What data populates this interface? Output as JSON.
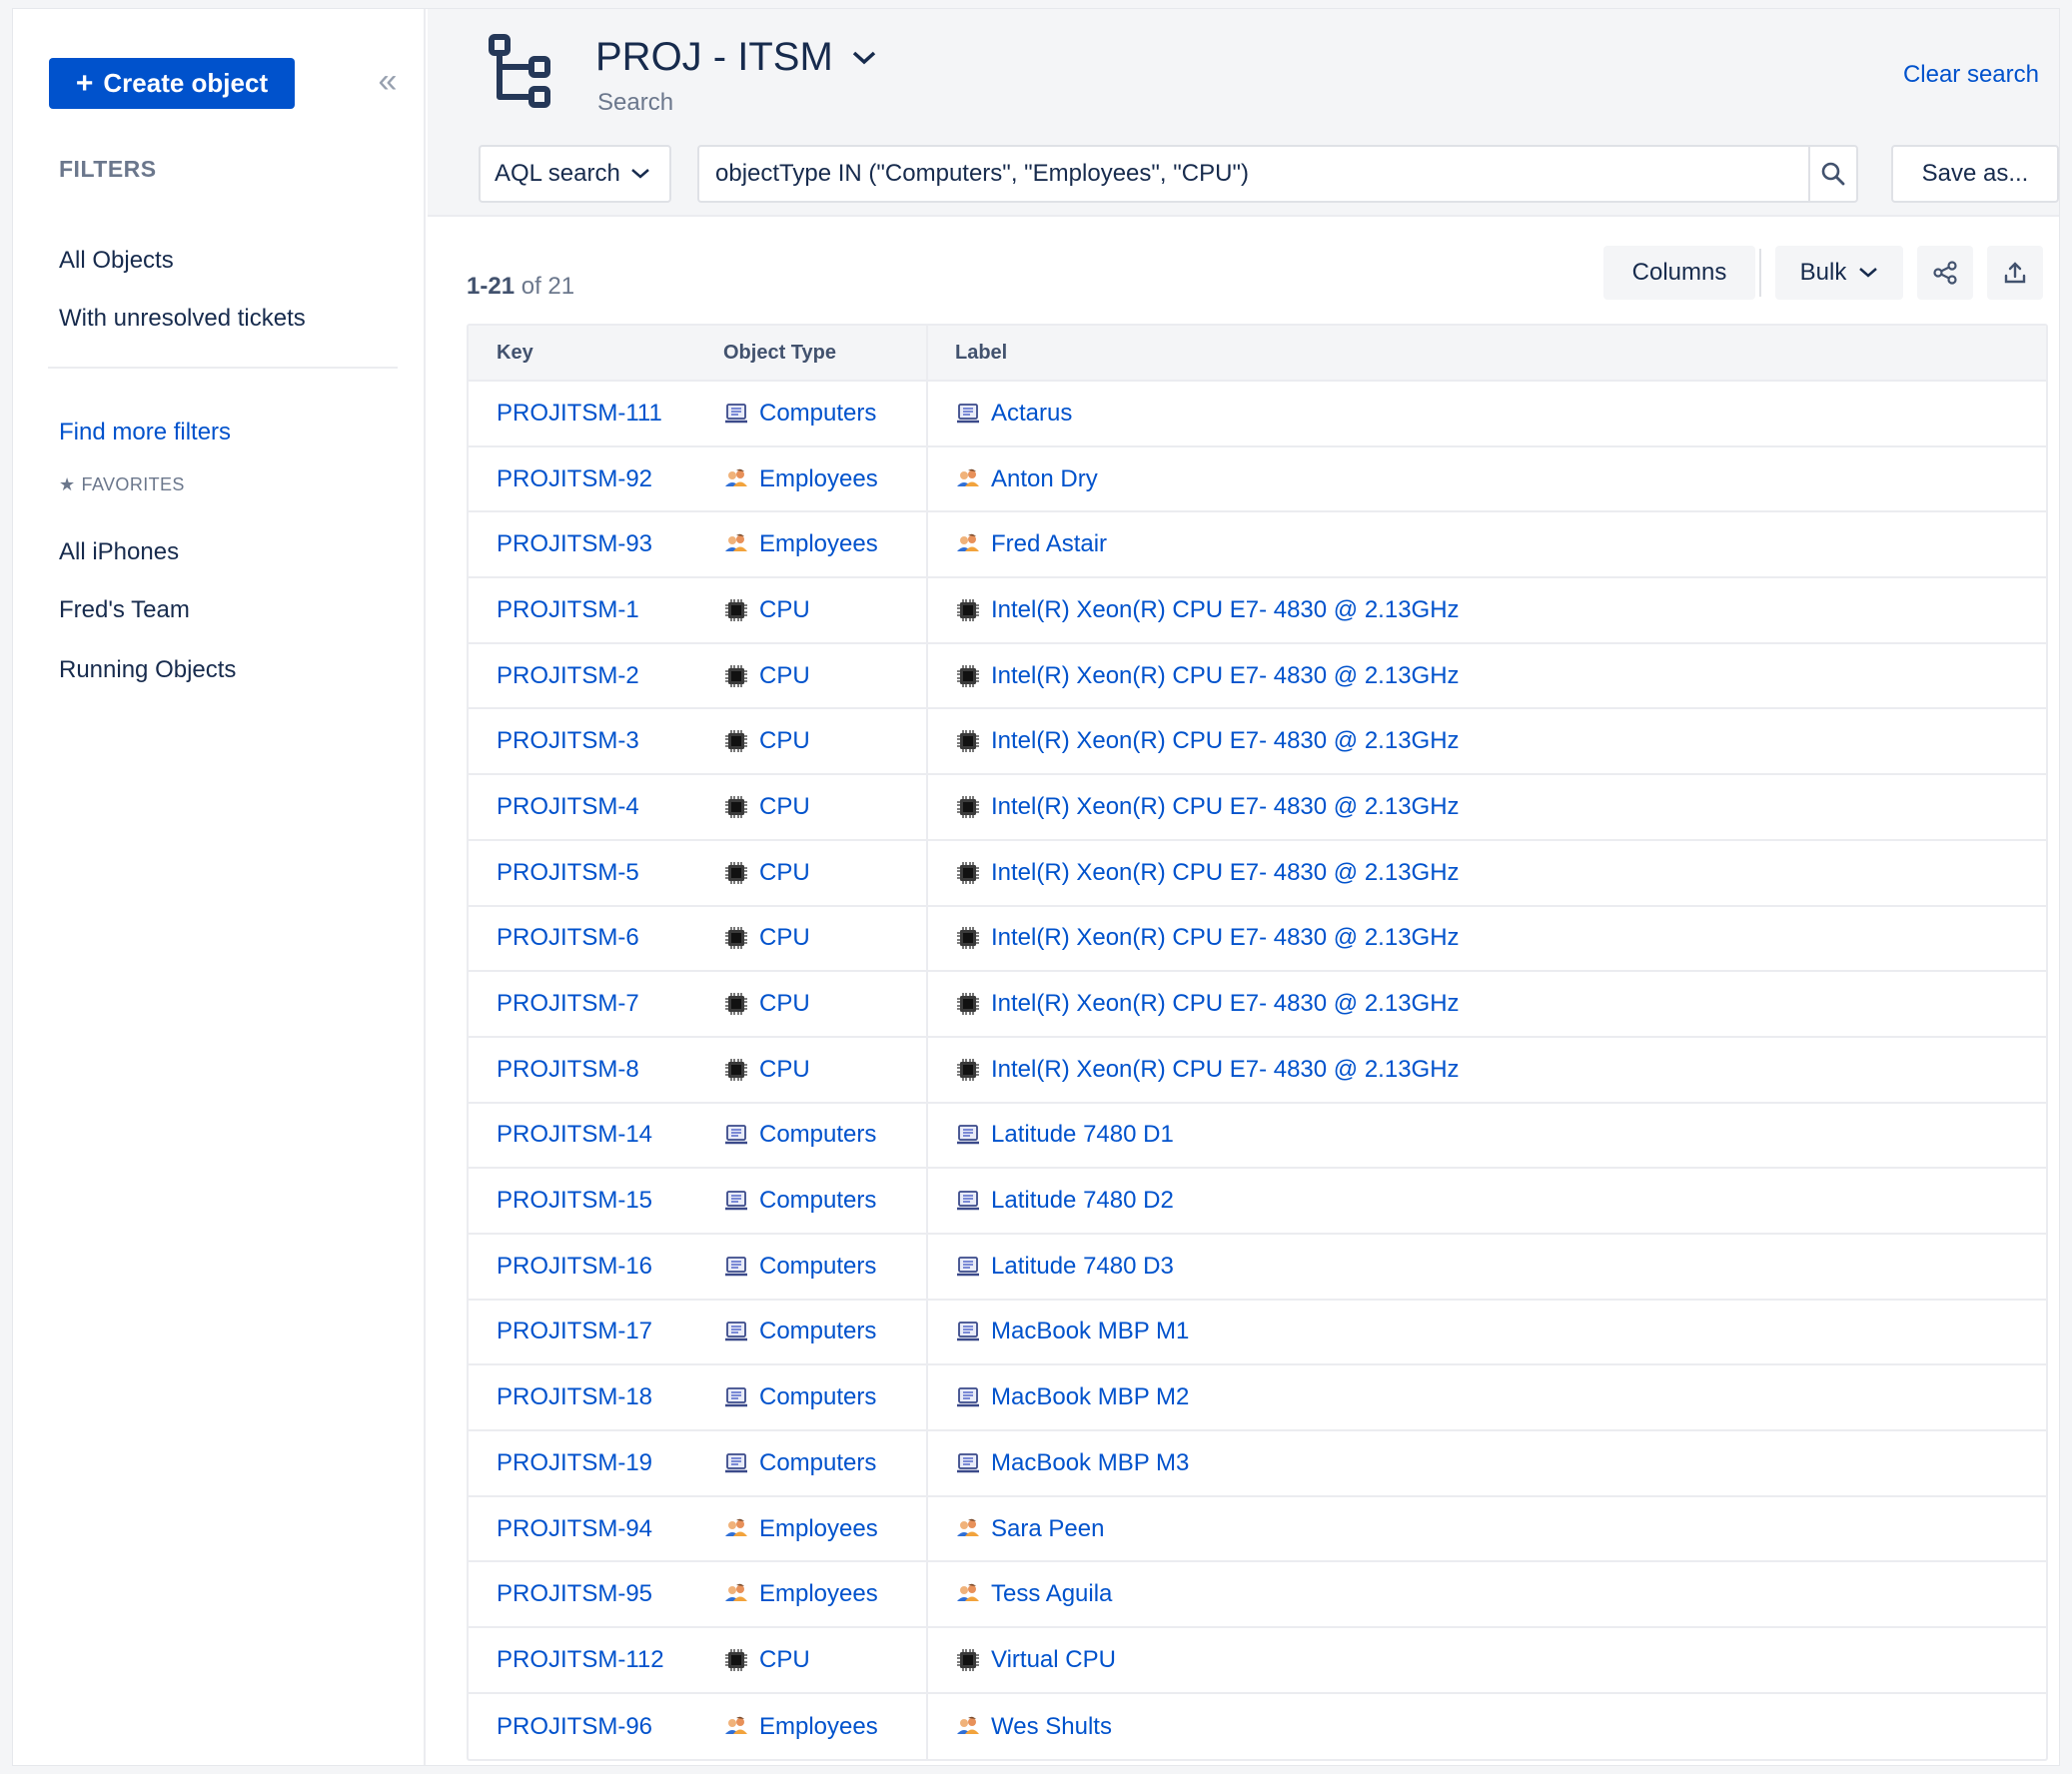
{
  "sidebar": {
    "create_label": "Create object",
    "filters_heading": "FILTERS",
    "filter_items": [
      "All Objects",
      "With unresolved tickets"
    ],
    "find_more": "Find more filters",
    "favorites_heading": "FAVORITES",
    "favorites": [
      "All iPhones",
      "Fred's Team",
      "Running Objects"
    ]
  },
  "header": {
    "title": "PROJ - ITSM",
    "subtitle": "Search",
    "clear_search": "Clear search",
    "search_mode": "AQL search",
    "query": "objectType IN (\"Computers\", \"Employees\", \"CPU\")",
    "save_as": "Save as..."
  },
  "toolbar": {
    "range": "1-21",
    "of_total": "of 21",
    "columns_label": "Columns",
    "bulk_label": "Bulk"
  },
  "table": {
    "headers": {
      "key": "Key",
      "type": "Object Type",
      "label": "Label"
    },
    "rows": [
      {
        "key": "PROJITSM-111",
        "type": "Computers",
        "icon": "computer-icon",
        "label": "Actarus"
      },
      {
        "key": "PROJITSM-92",
        "type": "Employees",
        "icon": "employees-icon",
        "label": "Anton Dry"
      },
      {
        "key": "PROJITSM-93",
        "type": "Employees",
        "icon": "employees-icon",
        "label": "Fred Astair"
      },
      {
        "key": "PROJITSM-1",
        "type": "CPU",
        "icon": "cpu-icon",
        "label": "Intel(R) Xeon(R) CPU E7- 4830 @ 2.13GHz"
      },
      {
        "key": "PROJITSM-2",
        "type": "CPU",
        "icon": "cpu-icon",
        "label": "Intel(R) Xeon(R) CPU E7- 4830 @ 2.13GHz"
      },
      {
        "key": "PROJITSM-3",
        "type": "CPU",
        "icon": "cpu-icon",
        "label": "Intel(R) Xeon(R) CPU E7- 4830 @ 2.13GHz"
      },
      {
        "key": "PROJITSM-4",
        "type": "CPU",
        "icon": "cpu-icon",
        "label": "Intel(R) Xeon(R) CPU E7- 4830 @ 2.13GHz"
      },
      {
        "key": "PROJITSM-5",
        "type": "CPU",
        "icon": "cpu-icon",
        "label": "Intel(R) Xeon(R) CPU E7- 4830 @ 2.13GHz"
      },
      {
        "key": "PROJITSM-6",
        "type": "CPU",
        "icon": "cpu-icon",
        "label": "Intel(R) Xeon(R) CPU E7- 4830 @ 2.13GHz"
      },
      {
        "key": "PROJITSM-7",
        "type": "CPU",
        "icon": "cpu-icon",
        "label": "Intel(R) Xeon(R) CPU E7- 4830 @ 2.13GHz"
      },
      {
        "key": "PROJITSM-8",
        "type": "CPU",
        "icon": "cpu-icon",
        "label": "Intel(R) Xeon(R) CPU E7- 4830 @ 2.13GHz"
      },
      {
        "key": "PROJITSM-14",
        "type": "Computers",
        "icon": "computer-icon",
        "label": "Latitude 7480 D1"
      },
      {
        "key": "PROJITSM-15",
        "type": "Computers",
        "icon": "computer-icon",
        "label": "Latitude 7480 D2"
      },
      {
        "key": "PROJITSM-16",
        "type": "Computers",
        "icon": "computer-icon",
        "label": "Latitude 7480 D3"
      },
      {
        "key": "PROJITSM-17",
        "type": "Computers",
        "icon": "computer-icon",
        "label": "MacBook MBP M1"
      },
      {
        "key": "PROJITSM-18",
        "type": "Computers",
        "icon": "computer-icon",
        "label": "MacBook MBP M2"
      },
      {
        "key": "PROJITSM-19",
        "type": "Computers",
        "icon": "computer-icon",
        "label": "MacBook MBP M3"
      },
      {
        "key": "PROJITSM-94",
        "type": "Employees",
        "icon": "employees-icon",
        "label": "Sara Peen"
      },
      {
        "key": "PROJITSM-95",
        "type": "Employees",
        "icon": "employees-icon",
        "label": "Tess Aguila"
      },
      {
        "key": "PROJITSM-112",
        "type": "CPU",
        "icon": "cpu-icon",
        "label": "Virtual CPU"
      },
      {
        "key": "PROJITSM-96",
        "type": "Employees",
        "icon": "employees-icon",
        "label": "Wes Shults"
      }
    ]
  },
  "colors": {
    "primary": "#0052cc",
    "text": "#172b4d",
    "muted": "#6b778c",
    "border": "#ebecf0"
  }
}
